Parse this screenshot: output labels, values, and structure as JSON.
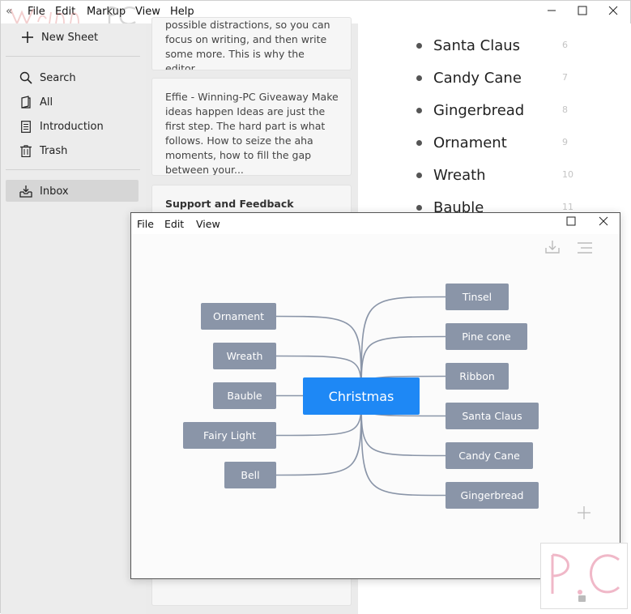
{
  "menu": {
    "file": "File",
    "edit": "Edit",
    "markup": "Markup",
    "view": "View",
    "help": "Help"
  },
  "sidebar": {
    "new_sheet": "New Sheet",
    "search": "Search",
    "all": "All",
    "introduction": "Introduction",
    "trash": "Trash",
    "inbox": "Inbox"
  },
  "sheets": {
    "card1": {
      "text": "possible distractions, so you can focus on writing, and then write some more. This is why the editor..."
    },
    "card2": {
      "text": "Effie - Winning-PC Giveaway Make ideas happen Ideas are just the first step. The hard part is what follows. How to seize the aha moments, how to fill the gap between your..."
    },
    "card3": {
      "title": "Support and Feedback"
    }
  },
  "editor": {
    "items": [
      {
        "text": "Santa Claus",
        "line": "6"
      },
      {
        "text": "Candy Cane",
        "line": "7"
      },
      {
        "text": "Gingerbread",
        "line": "8"
      },
      {
        "text": "Ornament",
        "line": "9"
      },
      {
        "text": "Wreath",
        "line": "10"
      },
      {
        "text": "Bauble",
        "line": "11"
      }
    ]
  },
  "mindmap_window": {
    "menu": {
      "file": "File",
      "edit": "Edit",
      "view": "View"
    },
    "root": "Christmas",
    "left_nodes": [
      "Ornament",
      "Wreath",
      "Bauble",
      "Fairy Light",
      "Bell"
    ],
    "right_nodes": [
      "Tinsel",
      "Pine cone",
      "Ribbon",
      "Santa Claus",
      "Candy Cane",
      "Gingerbread"
    ],
    "colors": {
      "root": "#1e88f5",
      "node": "#8a95a8",
      "edge": "#8a95a8"
    }
  },
  "watermark": {
    "brand": "Winning-PC"
  },
  "colors": {
    "sidebar_bg": "#ececec",
    "list_bg": "#ebebeb",
    "selected": "#d6d6d6"
  }
}
